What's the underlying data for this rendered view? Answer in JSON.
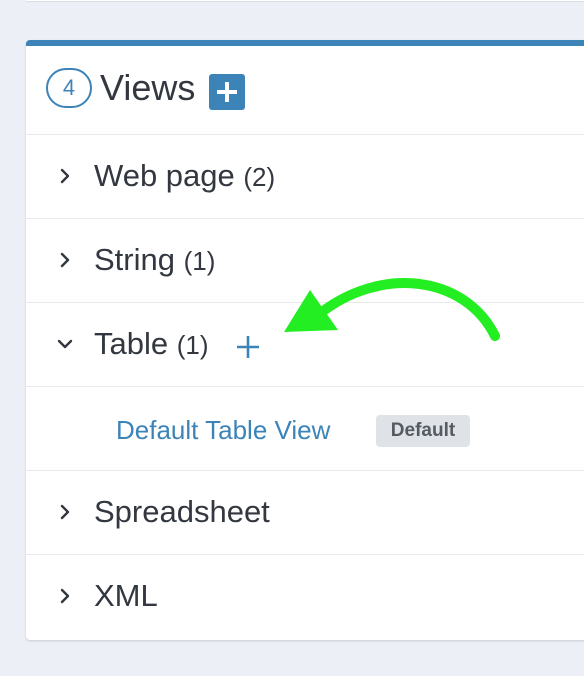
{
  "views": {
    "count": "4",
    "title": "Views",
    "add_button_icon": "plus-icon"
  },
  "rows": [
    {
      "label": "Web page",
      "count": "(2)",
      "expanded": false
    },
    {
      "label": "String",
      "count": "(1)",
      "expanded": false
    },
    {
      "label": "Table",
      "count": "(1)",
      "expanded": true
    },
    {
      "label": "Spreadsheet",
      "count": "",
      "expanded": false
    },
    {
      "label": "XML",
      "count": "",
      "expanded": false
    }
  ],
  "table_sub": {
    "link": "Default Table View",
    "badge": "Default"
  },
  "colors": {
    "accent": "#3c84b8",
    "annotation": "#22ee22",
    "background": "#eceff5"
  }
}
